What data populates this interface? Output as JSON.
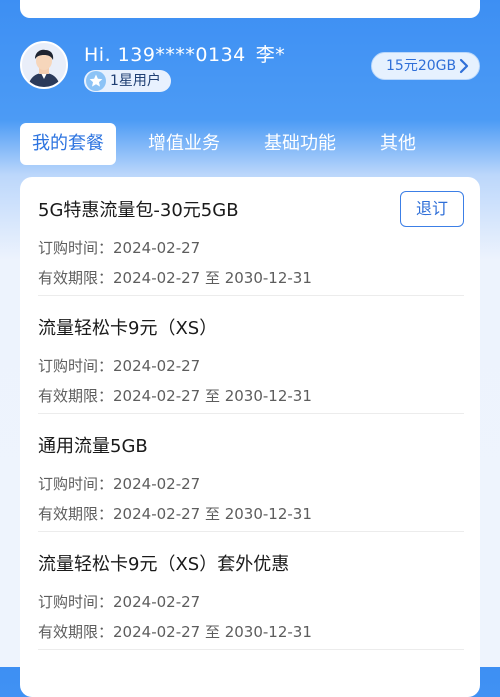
{
  "header": {
    "greeting": "Hi. 139****0134",
    "name": "李*",
    "level": "1星用户",
    "plan_summary": "15元20GB"
  },
  "tabs": [
    {
      "label": "我的套餐",
      "active": true
    },
    {
      "label": "增值业务",
      "active": false
    },
    {
      "label": "基础功能",
      "active": false
    },
    {
      "label": "其他",
      "active": false
    }
  ],
  "packages": [
    {
      "title": "5G特惠流量包-30元5GB",
      "order_label": "订购时间：",
      "order_date": "2024-02-27",
      "valid_label": "有效期限：",
      "valid_range": "2024-02-27 至 2030-12-31",
      "action": "退订"
    },
    {
      "title": "流量轻松卡9元（XS）",
      "order_label": "订购时间：",
      "order_date": "2024-02-27",
      "valid_label": "有效期限：",
      "valid_range": "2024-02-27 至 2030-12-31"
    },
    {
      "title": "通用流量5GB",
      "order_label": "订购时间：",
      "order_date": "2024-02-27",
      "valid_label": "有效期限：",
      "valid_range": "2024-02-27 至 2030-12-31"
    },
    {
      "title": "流量轻松卡9元（XS）套外优惠",
      "order_label": "订购时间：",
      "order_date": "2024-02-27",
      "valid_label": "有效期限：",
      "valid_range": "2024-02-27 至 2030-12-31"
    }
  ],
  "colors": {
    "primary": "#2d74e0",
    "header_blue": "#3d8ff3"
  },
  "icons": {
    "avatar": "user-avatar-icon",
    "level": "star-badge-icon",
    "pill": "chevron-right-icon"
  }
}
